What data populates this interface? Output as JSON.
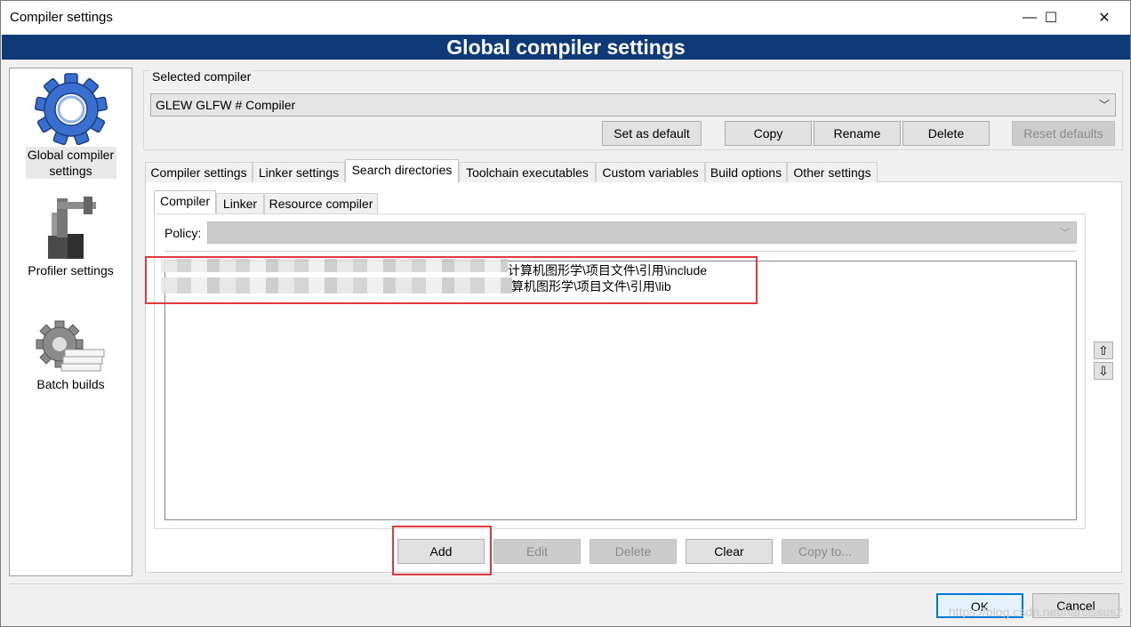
{
  "window": {
    "title": "Compiler settings",
    "controls": {
      "minimize": "—",
      "maximize": "☐",
      "close": "✕"
    }
  },
  "banner": "Global compiler settings",
  "sidebar": {
    "items": [
      {
        "label": "Global compiler settings",
        "icon": "gear-icon"
      },
      {
        "label": "Profiler settings",
        "icon": "profiler-icon"
      },
      {
        "label": "Batch builds",
        "icon": "batch-builds-icon"
      }
    ]
  },
  "selected_compiler": {
    "legend": "Selected compiler",
    "value": "GLEW GLFW # Compiler",
    "buttons": {
      "set_default": "Set as default",
      "copy": "Copy",
      "rename": "Rename",
      "delete": "Delete",
      "reset": "Reset defaults"
    }
  },
  "tabs": [
    "Compiler settings",
    "Linker settings",
    "Search directories",
    "Toolchain executables",
    "Custom variables",
    "Build options",
    "Other settings"
  ],
  "subtabs": [
    "Compiler",
    "Linker",
    "Resource compiler"
  ],
  "policy": {
    "label": "Policy:",
    "value": ""
  },
  "directories": [
    "计算机图形学\\项目文件\\引用\\include",
    "算机图形学\\项目文件\\引用\\lib"
  ],
  "order": {
    "up": "⇧",
    "down": "⇩"
  },
  "actions": {
    "add": "Add",
    "edit": "Edit",
    "delete": "Delete",
    "clear": "Clear",
    "copy_to": "Copy to..."
  },
  "footer": {
    "ok": "OK",
    "cancel": "Cancel"
  },
  "watermark": "https://blog.csdn.net/narcissus2",
  "colors": {
    "banner": "#0f3a78",
    "highlight": "#e0393e",
    "ok_border": "#0078d7"
  }
}
